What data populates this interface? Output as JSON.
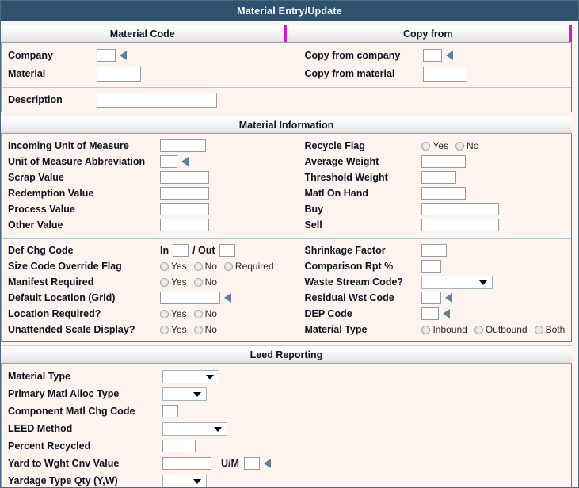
{
  "window": {
    "title": "Material Entry/Update"
  },
  "sections": {
    "material_code": {
      "header_left": "Material Code",
      "header_right": "Copy from",
      "fields": {
        "company": {
          "label": "Company",
          "value": "",
          "lookup_icon": "lookup-arrow-icon"
        },
        "material": {
          "label": "Material",
          "value": ""
        },
        "copy_from_company": {
          "label": "Copy from company",
          "value": "",
          "lookup_icon": "lookup-arrow-icon"
        },
        "copy_from_material": {
          "label": "Copy from material",
          "value": ""
        },
        "description": {
          "label": "Description",
          "value": ""
        }
      }
    },
    "material_information": {
      "header": "Material Information",
      "left_fields": [
        {
          "name": "incoming-unit-of-measure",
          "label": "Incoming Unit of Measure",
          "type": "text",
          "value": "",
          "width": 58
        },
        {
          "name": "unit-of-measure-abbreviation",
          "label": "Unit of Measure Abbreviation",
          "type": "text-lookup",
          "value": "",
          "width": 22
        },
        {
          "name": "scrap-value",
          "label": "Scrap Value",
          "type": "text",
          "value": "",
          "width": 62
        },
        {
          "name": "redemption-value",
          "label": "Redemption Value",
          "type": "text",
          "value": "",
          "width": 62
        },
        {
          "name": "process-value",
          "label": "Process Value",
          "type": "text",
          "value": "",
          "width": 62
        },
        {
          "name": "other-value",
          "label": "Other Value",
          "type": "text",
          "value": "",
          "width": 62
        }
      ],
      "right_fields": [
        {
          "name": "recycle-flag",
          "label": "Recycle Flag",
          "type": "radio",
          "options": [
            "Yes",
            "No"
          ],
          "selected": ""
        },
        {
          "name": "average-weight",
          "label": "Average Weight",
          "type": "text",
          "value": "",
          "width": 56
        },
        {
          "name": "threshold-weight",
          "label": "Threshold Weight",
          "type": "text",
          "value": "",
          "width": 44
        },
        {
          "name": "matl-on-hand",
          "label": "Matl On Hand",
          "type": "text",
          "value": "",
          "width": 56
        },
        {
          "name": "buy",
          "label": "Buy",
          "type": "text",
          "value": "",
          "width": 98
        },
        {
          "name": "sell",
          "label": "Sell",
          "type": "text",
          "value": "",
          "width": 98
        }
      ],
      "left_fields2": [
        {
          "name": "def-chg-code",
          "label": "Def Chg Code",
          "type": "in-out",
          "in_label": "In",
          "out_label": "/ Out",
          "in_value": "",
          "out_value": ""
        },
        {
          "name": "size-code-override-flag",
          "label": "Size Code Override Flag",
          "type": "radio",
          "options": [
            "Yes",
            "No",
            "Required"
          ],
          "selected": ""
        },
        {
          "name": "manifest-required",
          "label": "Manifest Required",
          "type": "radio",
          "options": [
            "Yes",
            "No"
          ],
          "selected": ""
        },
        {
          "name": "default-location-grid",
          "label": "Default Location (Grid)",
          "type": "text-lookup",
          "value": "",
          "width": 76
        },
        {
          "name": "location-required",
          "label": "Location Required?",
          "type": "radio",
          "options": [
            "Yes",
            "No"
          ],
          "selected": ""
        },
        {
          "name": "unattended-scale-display",
          "label": "Unattended Scale Display?",
          "type": "radio",
          "options": [
            "Yes",
            "No"
          ],
          "selected": ""
        }
      ],
      "right_fields2": [
        {
          "name": "shrinkage-factor",
          "label": "Shrinkage Factor",
          "type": "text",
          "value": "",
          "width": 32
        },
        {
          "name": "comparison-rpt-pct",
          "label": "Comparison Rpt %",
          "type": "text",
          "value": "",
          "width": 25
        },
        {
          "name": "waste-stream-code",
          "label": "Waste Stream Code?",
          "type": "dropdown",
          "value": "",
          "width": 90
        },
        {
          "name": "residual-wst-code",
          "label": "Residual Wst Code",
          "type": "text-lookup",
          "value": "",
          "width": 25
        },
        {
          "name": "dep-code",
          "label": "DEP Code",
          "type": "text-lookup",
          "value": "",
          "width": 22
        },
        {
          "name": "material-type",
          "label": "Material Type",
          "type": "radio",
          "options": [
            "Inbound",
            "Outbound",
            "Both"
          ],
          "selected": ""
        }
      ]
    },
    "leed_reporting": {
      "header": "Leed Reporting",
      "fields": [
        {
          "name": "leed-material-type",
          "label": "Material Type",
          "type": "dropdown",
          "value": "",
          "width": 72
        },
        {
          "name": "primary-matl-alloc-type",
          "label": "Primary Matl Alloc Type",
          "type": "dropdown",
          "value": "",
          "width": 56
        },
        {
          "name": "component-matl-chg-code",
          "label": "Component Matl Chg Code",
          "type": "text",
          "value": "",
          "width": 20
        },
        {
          "name": "leed-method",
          "label": "LEED Method",
          "type": "dropdown",
          "value": "",
          "width": 82
        },
        {
          "name": "percent-recycled",
          "label": "Percent Recycled",
          "type": "text",
          "value": "",
          "width": 42
        },
        {
          "name": "yard-to-wght-cnv-value",
          "label": "Yard to Wght Cnv Value",
          "type": "text-um",
          "value": "",
          "width": 62,
          "um_label": "U/M",
          "um_value": ""
        },
        {
          "name": "yardage-type-qty",
          "label": "Yardage Type Qty (Y,W)",
          "type": "dropdown",
          "value": "",
          "width": 56
        }
      ]
    }
  },
  "colors": {
    "titlebar": "#2f5270",
    "background": "#fdf3ef",
    "accent_magenta": "#d618d6",
    "lookup_arrow": "#5b7f9c",
    "panel_border": "#5d7b8d"
  }
}
